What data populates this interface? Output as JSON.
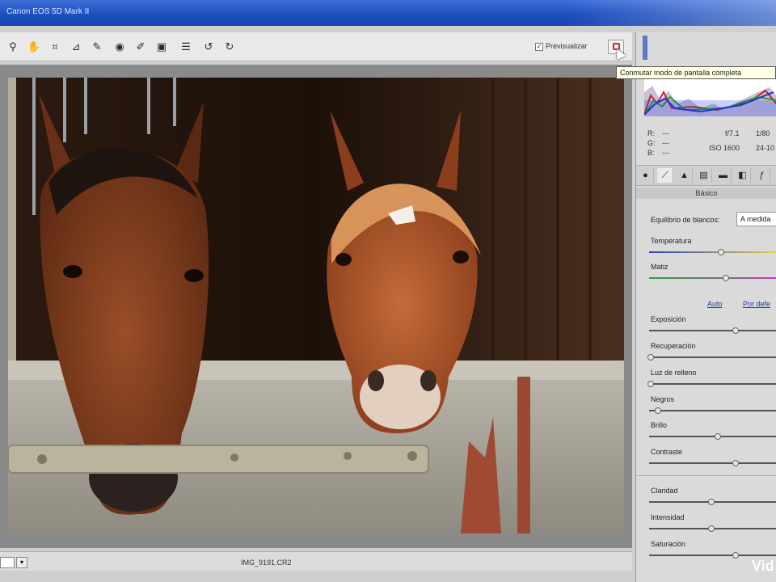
{
  "window": {
    "title": "Canon EOS 5D Mark II"
  },
  "toolbar": {
    "tools": [
      {
        "name": "zoom-tool-icon",
        "glyph": "⚲"
      },
      {
        "name": "hand-tool-icon",
        "glyph": "✋"
      },
      {
        "name": "crop-tool-icon",
        "glyph": "⌗"
      },
      {
        "name": "straighten-tool-icon",
        "glyph": "⊿"
      },
      {
        "name": "spot-removal-icon",
        "glyph": "✎"
      },
      {
        "name": "red-eye-icon",
        "glyph": "◉"
      },
      {
        "name": "brush-icon",
        "glyph": "✐"
      },
      {
        "name": "gradient-filter-icon",
        "glyph": "▣"
      },
      {
        "name": "preferences-icon",
        "glyph": "☰"
      },
      {
        "name": "rotate-left-icon",
        "glyph": "↺"
      },
      {
        "name": "rotate-right-icon",
        "glyph": "↻"
      }
    ],
    "preview_label": "Previsualizar",
    "preview_checked": true
  },
  "tooltip": "Conmutar modo de pantalla completa",
  "bottombar": {
    "filename": "IMG_9191.CR2"
  },
  "readout": {
    "r_label": "R:",
    "r_value": "---",
    "g_label": "G:",
    "g_value": "---",
    "b_label": "B:",
    "b_value": "---",
    "aperture": "f/7.1",
    "shutter": "1/80",
    "iso": "ISO 1600",
    "lens": "24-10"
  },
  "panel": {
    "section_title": "Básico",
    "wb_label": "Equilibrio de blancos:",
    "wb_value": "A medida",
    "auto_link": "Auto",
    "default_link": "Por defe",
    "sliders": [
      {
        "label": "Temperatura",
        "value": 0.58
      },
      {
        "label": "Matiz",
        "value": 0.62
      },
      {
        "label": "Exposición",
        "value": 0.7
      },
      {
        "label": "Recuperación",
        "value": 0.0
      },
      {
        "label": "Luz de relleno",
        "value": 0.0
      },
      {
        "label": "Negros",
        "value": 0.06
      },
      {
        "label": "Brillo",
        "value": 0.55
      },
      {
        "label": "Contraste",
        "value": 0.7
      },
      {
        "label": "Claridad",
        "value": 0.5
      },
      {
        "label": "Intensidad",
        "value": 0.5
      },
      {
        "label": "Saturación",
        "value": 0.7
      }
    ]
  },
  "watermark": "Vid"
}
